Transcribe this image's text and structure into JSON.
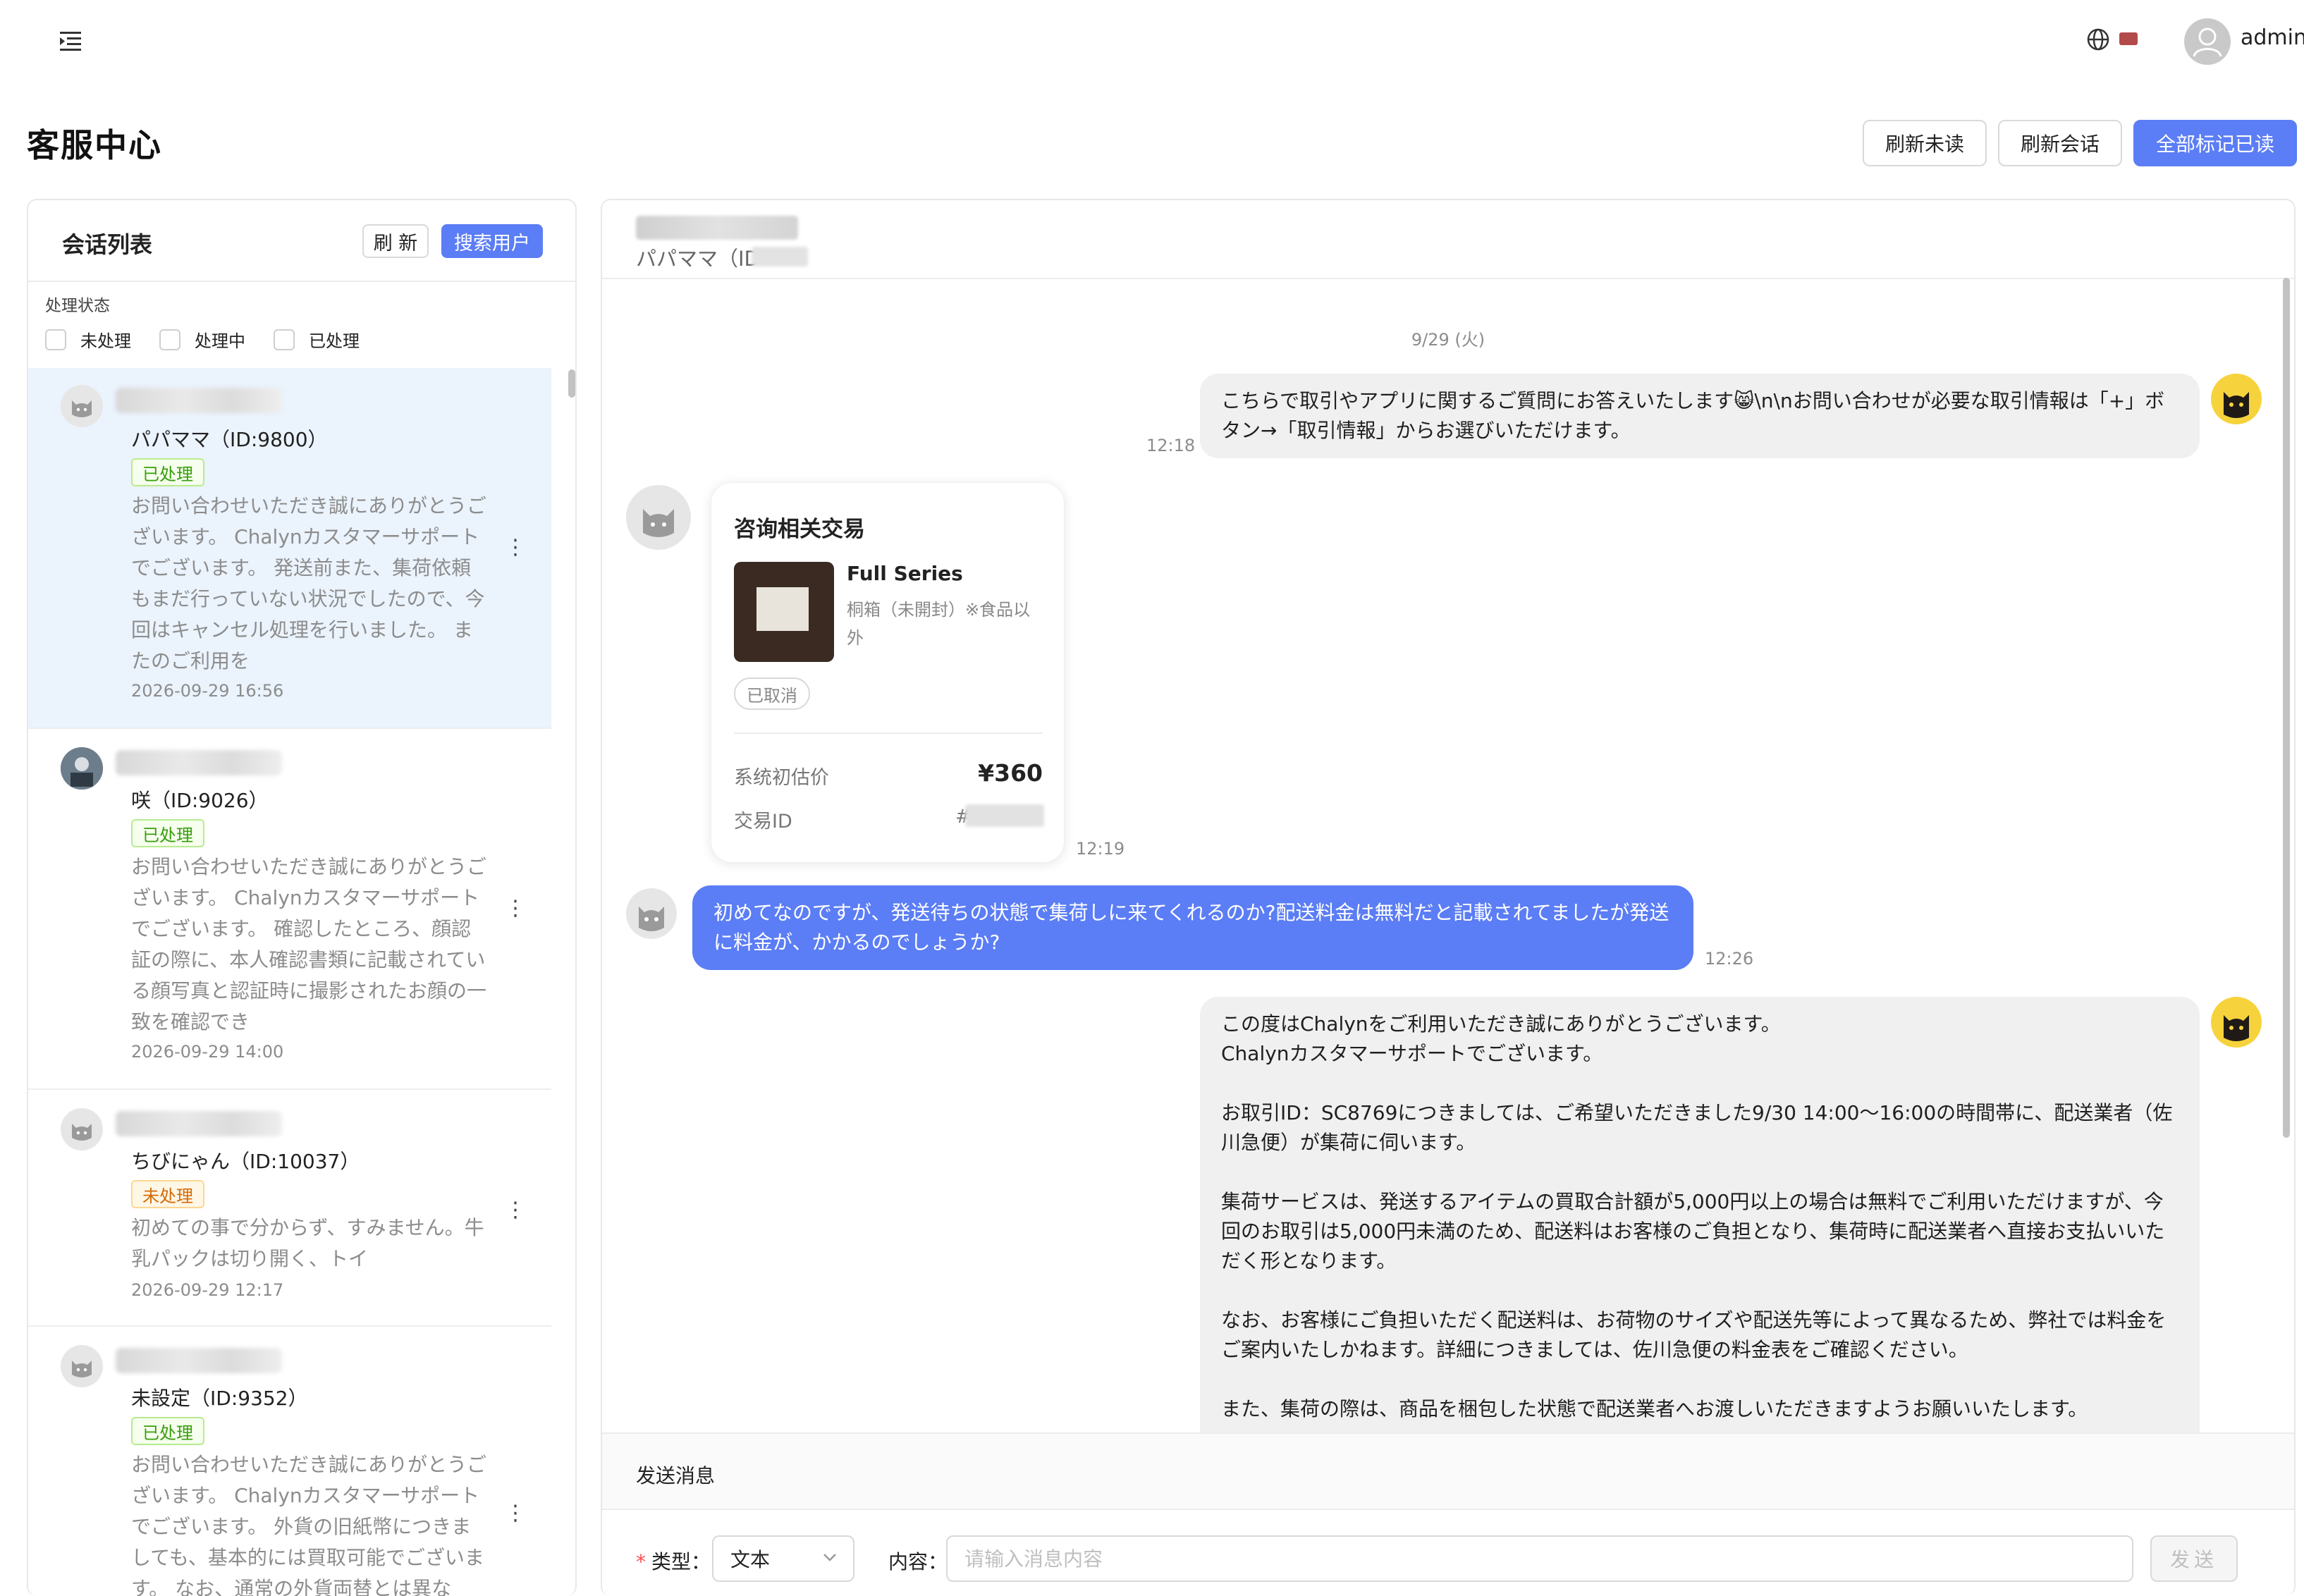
{
  "header": {
    "menu_icon": "menu-fold-icon",
    "globe_icon": "globe-icon",
    "flag_icon": "flag-icon",
    "user_name": "admin"
  },
  "page": {
    "title": "客服中心",
    "buttons": {
      "refresh_unread": "刷新未读",
      "refresh_sessions": "刷新会话",
      "mark_all_read": "全部标记已读"
    }
  },
  "colors": {
    "primary": "#5b7df5",
    "selected_row": "#ebf3fd",
    "tag_done": "#389e0d",
    "tag_todo": "#d46b08"
  },
  "sidebar": {
    "title": "会话列表",
    "refresh_label": "刷 新",
    "search_label": "搜索用户",
    "filter_label": "处理状态",
    "filters": [
      "未处理",
      "处理中",
      "已处理"
    ],
    "conversations": [
      {
        "name": "パパママ（ID:9800）",
        "status": "已处理",
        "status_kind": "done",
        "preview": "お問い合わせいただき誠にありがとうございます。 Chalynカスタマーサポートでございます。 発送前また、集荷依頼もまだ行っていない状況でしたので、今回はキャンセル処理を行いました。 またのご利用を",
        "date": "2026-09-29 16:56",
        "selected": true
      },
      {
        "name": "咲（ID:9026）",
        "status": "已处理",
        "status_kind": "done",
        "preview": "お問い合わせいただき誠にありがとうございます。 Chalynカスタマーサポートでございます。 確認したところ、顔認証の際に、本人確認書類に記載されている顔写真と認証時に撮影されたお顔の一致を確認でき",
        "date": "2026-09-29 14:00",
        "selected": false
      },
      {
        "name": "ちびにゃん（ID:10037）",
        "status": "未处理",
        "status_kind": "todo",
        "preview": "初めての事で分からず、すみません。牛乳パックは切り開く、トイ",
        "date": "2026-09-29 12:17",
        "selected": false
      },
      {
        "name": "未設定（ID:9352）",
        "status": "已处理",
        "status_kind": "done",
        "preview": "お問い合わせいただき誠にありがとうございます。 Chalynカスタマーサポートでございます。 外貨の旧紙幣につきましても、基本的には買取可能でございます。 なお、通常の外貨両替とは異な",
        "date": "",
        "selected": false
      }
    ]
  },
  "chat": {
    "user_subtitle": "パパママ（ID",
    "date_separator": "9/29 (火)",
    "messages": {
      "m1_text": "こちらで取引やアプリに関するご質問にお答えいたします😸\\n\\nお問い合わせが必要な取引情報は「+」ボタン→「取引情報」からお選びいただけます。",
      "m1_time": "12:18",
      "card_time": "12:19",
      "m3_text": "初めてなのですが、発送待ちの状態で集荷しに来てくれるのか?配送料金は無料だと記載されてましたが発送に料金が、かかるのでしょうか?",
      "m3_time": "12:26",
      "m4_lines": [
        "この度はChalynをご利用いただき誠にありがとうございます。",
        "Chalynカスタマーサポートでございます。",
        "",
        "お取引ID：SC8769につきましては、ご希望いただきました9/30 14:00～16:00の時間帯に、配送業者（佐川急便）が集荷に伺います。",
        "",
        "集荷サービスは、発送するアイテムの買取合計額が5,000円以上の場合は無料でご利用いただけますが、今回のお取引は5,000円未満のため、配送料はお客様のご負担となり、集荷時に配送業者へ直接お支払いいただく形となります。",
        "",
        "なお、お客様にご負担いただく配送料は、お荷物のサイズや配送先等によって異なるため、弊社では料金をご案内いたしかねます。詳細につきましては、佐川急便の料金表をご確認ください。",
        "",
        "また、集荷の際は、商品を梱包した状態で配送業者へお渡しいただきますようお願いいたします。"
      ]
    },
    "card": {
      "title": "咨询相关交易",
      "product_name": "Full Series",
      "product_desc": "桐箱（未開封）※食品以外",
      "status": "已取消",
      "price_label": "系统初估价",
      "price": "¥360",
      "txid_label": "交易ID",
      "txid_prefix": "#"
    }
  },
  "composer": {
    "title": "发送消息",
    "type_label": "类型",
    "type_value": "文本",
    "content_label": "内容",
    "content_placeholder": "请输入消息内容",
    "send_label": "发送"
  }
}
